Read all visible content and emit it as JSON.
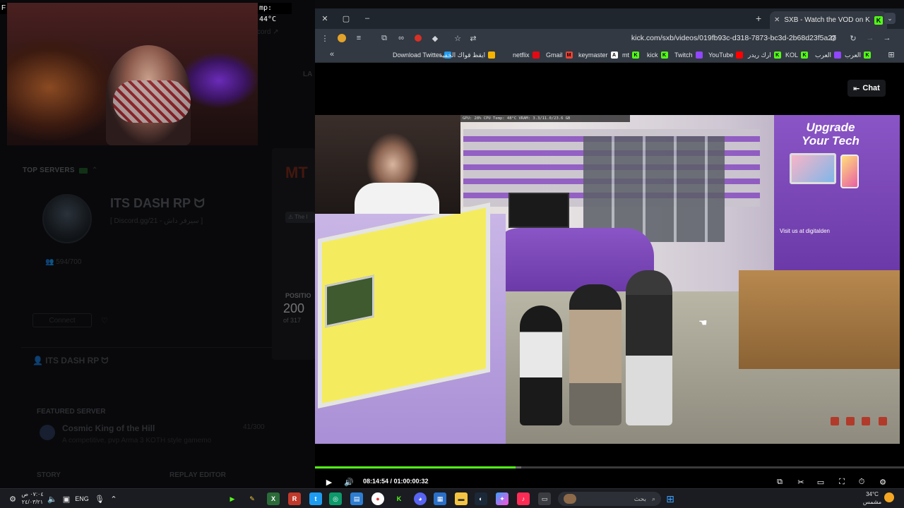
{
  "background_site": {
    "top_servers_label": "TOP SERVERS",
    "server_name": "ITS DASH RP ᗢ",
    "server_sub": "[ Discord.gg/21 - سيرفر داش ]",
    "server_count": "594/700",
    "connect_label": "Connect",
    "server_row2_name": "ITS DASH RP ᗢ",
    "featured_label": "FEATURED SERVER",
    "featured_name": "Cosmic King of the Hill",
    "featured_desc": "A competitive, pvp Arma 3 KOTH style gamemo",
    "featured_count": "41/300",
    "story_label": "STORY",
    "replay_label": "REPLAY EDITOR",
    "card_link": "cord",
    "la_label": "LA",
    "mt_logo": "MT",
    "pill_text": "The I",
    "position_label": "POSITIO",
    "position_value": "200",
    "position_of": "of 317"
  },
  "webcam": {
    "temp_label": "mp: 44°C",
    "f_label": "F"
  },
  "browser": {
    "tab_title": "SXB - Watch the VOD on Kick",
    "url": "kick.com/sxb/videos/019fb93c-d318-7873-bc3d-2b68d23f5a27",
    "bookmarks": [
      {
        "label": "Download Twitter",
        "icon": "twitter-icon",
        "color": "#1d9bf0",
        "glyph": ""
      },
      {
        "label": "ايقظ قواك الخفيه",
        "icon": "drive-icon",
        "color": "#f5b400",
        "glyph": ""
      },
      {
        "label": "netflix",
        "icon": "netflix-icon",
        "color": "#e50914",
        "glyph": ""
      },
      {
        "label": "Gmail",
        "icon": "gmail-icon",
        "color": "#ea4335",
        "glyph": "M"
      },
      {
        "label": "keymaster",
        "icon": "keymaster-icon",
        "color": "#ffffff",
        "glyph": "A"
      },
      {
        "label": "mt",
        "icon": "kick-icon",
        "color": "#53fc18",
        "glyph": "K"
      },
      {
        "label": "kick",
        "icon": "kick-icon",
        "color": "#53fc18",
        "glyph": "K"
      },
      {
        "label": "Twitch",
        "icon": "twitch-icon",
        "color": "#9146ff",
        "glyph": ""
      },
      {
        "label": "YouTube",
        "icon": "youtube-icon",
        "color": "#ff0000",
        "glyph": ""
      },
      {
        "label": "ارك ريدر",
        "icon": "kick-icon",
        "color": "#53fc18",
        "glyph": "K"
      },
      {
        "label": "KOL",
        "icon": "kick-icon",
        "color": "#53fc18",
        "glyph": "K"
      },
      {
        "label": "العرب",
        "icon": "twitch-icon",
        "color": "#9146ff",
        "glyph": ""
      },
      {
        "label": "العرب",
        "icon": "kick-icon",
        "color": "#53fc18",
        "glyph": "K"
      }
    ],
    "chat_label": "Chat",
    "time_display": "08:14:54 / 01:00:00:32",
    "progress_fraction": 0.34,
    "buffer_fraction": 0.35,
    "hud_text": "GPU: 28%    CPU Temp: 48°C   VRAM: 3.3/11.0/23.6 GB",
    "video_sign": "Upgrade Your Tech",
    "video_visit": "Visit us at digitalden",
    "accent_color": "#53fc18"
  },
  "taskbar": {
    "clock_time": "٠٧:٠٤ ص",
    "clock_date": "٢٤/٠٣/٢١",
    "lang": "ENG",
    "search_placeholder": "بحث",
    "weather_temp": "34°C",
    "weather_desc": "مشمس"
  }
}
